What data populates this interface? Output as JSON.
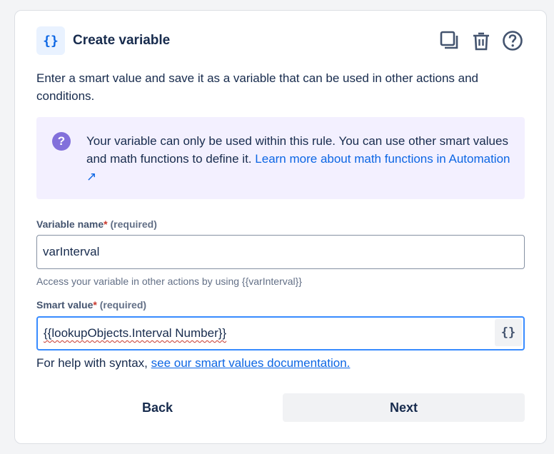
{
  "header": {
    "icon_glyph": "{}",
    "icon": "curly-braces-icon",
    "title": "Create variable",
    "actions": [
      "duplicate-icon",
      "trash-icon",
      "help-circle-icon"
    ]
  },
  "description": "Enter a smart value and save it as a variable that can be used in other actions and conditions.",
  "info": {
    "icon_glyph": "?",
    "text": "Your variable can only be used within this rule. You can use other smart values and math functions to define it.",
    "link_text": "Learn more about math functions in Automation ↗"
  },
  "variable_name": {
    "label": "Variable name",
    "required_star": "*",
    "required_text": "(required)",
    "value": "varInterval",
    "helper": "Access your variable in other actions by using {{varInterval}}"
  },
  "smart_value": {
    "label": "Smart value",
    "required_star": "*",
    "required_text": "(required)",
    "value": "{{lookupObjects.Interval Number}}",
    "insert_button_glyph": "{}"
  },
  "help": {
    "prefix": "For help with syntax,",
    "link_text": "see our smart values documentation."
  },
  "buttons": {
    "back": "Back",
    "next": "Next"
  },
  "colors": {
    "accent": "#0c66e4",
    "info_bg": "#f3f0ff",
    "info_icon": "#8270db",
    "required": "#c9372c",
    "focus_border": "#388bff"
  }
}
